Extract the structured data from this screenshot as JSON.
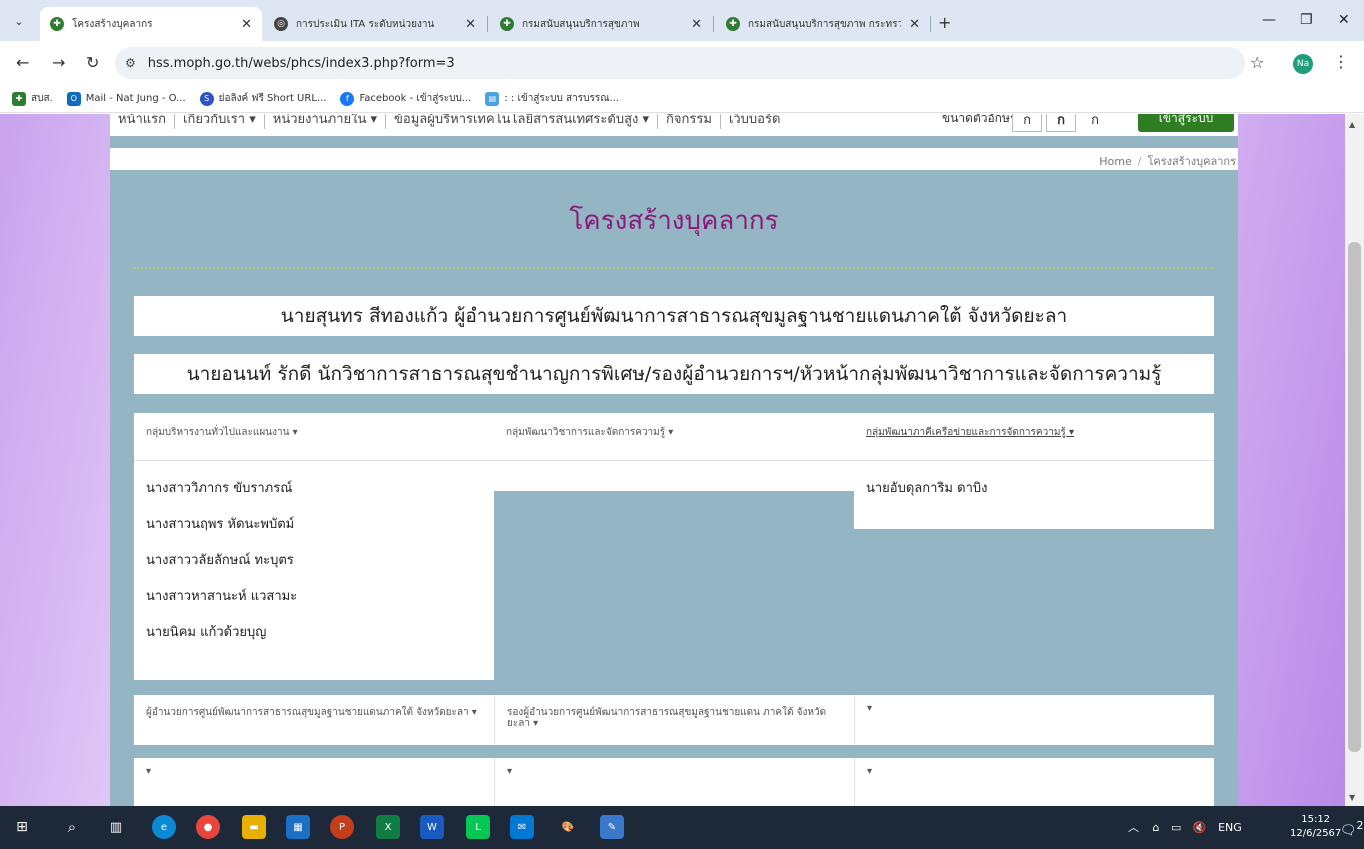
{
  "browser": {
    "tabs": [
      {
        "title": "โครงสร้างบุคลากร",
        "active": true
      },
      {
        "title": "การประเมิน ITA ระดับหน่วยงาน",
        "active": false
      },
      {
        "title": "กรมสนับสนุนบริการสุขภาพ",
        "active": false
      },
      {
        "title": "กรมสนับสนุนบริการสุขภาพ กระทรว",
        "active": false
      }
    ],
    "url": "hss.moph.go.th/webs/phcs/index3.php?form=3",
    "profile_initials": "Na",
    "bookmarks": [
      "สบส.",
      "Mail - Nat Jung - O...",
      "ย่อลิงค์ ฟรี Short URL...",
      "Facebook - เข้าสู่ระบบ...",
      ": : เข้าสู่ระบบ สารบรรณ..."
    ]
  },
  "site": {
    "nav": [
      "หน้าแรก",
      "เกี่ยวกับเรา ▾",
      "หน่วยงานภายใน ▾",
      "ข้อมูลผู้บริหารเทคโนโลยีสารสนเทศระดับสูง ▾",
      "กิจกรรม",
      "เว็บบอร์ด"
    ],
    "font_size_label": "ขนาดตัวอักษร",
    "font_buttons": [
      "ก",
      "ก",
      "ก"
    ],
    "login_label": "เข้าสู่ระบบ",
    "breadcrumb": {
      "home": "Home",
      "sep": "/",
      "current": "โครงสร้างบุคลากร"
    }
  },
  "page": {
    "title": "โครงสร้างบุคลากร",
    "director": "นายสุนทร สีทองแก้ว ผู้อำนวยการศูนย์พัฒนาการสาธารณสุขมูลฐานชายแดนภาคใต้ จังหวัดยะลา",
    "deputy": "นายอนนท์ รักดี นักวิชาการสาธารณสุขชำนาญการพิเศษ/รองผู้อำนวยการฯ/หัวหน้ากลุ่มพัฒนาวิชาการและจัดการความรู้",
    "groups": [
      {
        "title": "กลุ่มบริหารงานทั่วไปและแผนงาน ▾",
        "members": [
          "นางสาววิภากร ขับราภรณ์",
          "นางสาวนฤพร หัดนะพบัตม์",
          "นางสาววลัยลักษณ์ ทะบุตร",
          "นางสาวหาสานะห์ แวสามะ",
          "นายนิคม แก้วด้วยบุญ"
        ]
      },
      {
        "title": "กลุ่มพัฒนาวิชาการและจัดการความรู้ ▾",
        "members": []
      },
      {
        "title": "กลุ่มพัฒนาภาคีเครือข่ายและการจัดการความรู้ ▾",
        "members": [
          "นายอับดุลการิม ดาบิง"
        ]
      }
    ],
    "row2": [
      "ผู้อำนวยการศูนย์พัฒนาการสาธารณสุขมูลฐานชายแดนภาคใต้ จังหวัดยะลา ▾",
      "รองผู้อำนวยการศูนย์พัฒนาการสาธารณสุขมูลฐานชายแดน ภาคใต้ จังหวัดยะลา ▾",
      "▾"
    ],
    "row3": [
      "▾",
      "▾",
      "▾"
    ]
  },
  "taskbar": {
    "tray": "ENG",
    "time": "15:12",
    "date": "12/6/2567",
    "notifications": "2"
  },
  "colors": {
    "title": "#8a1a78",
    "content_bg": "#93b5c4",
    "login": "#2e7d22",
    "taskbar": "#1d2838"
  }
}
